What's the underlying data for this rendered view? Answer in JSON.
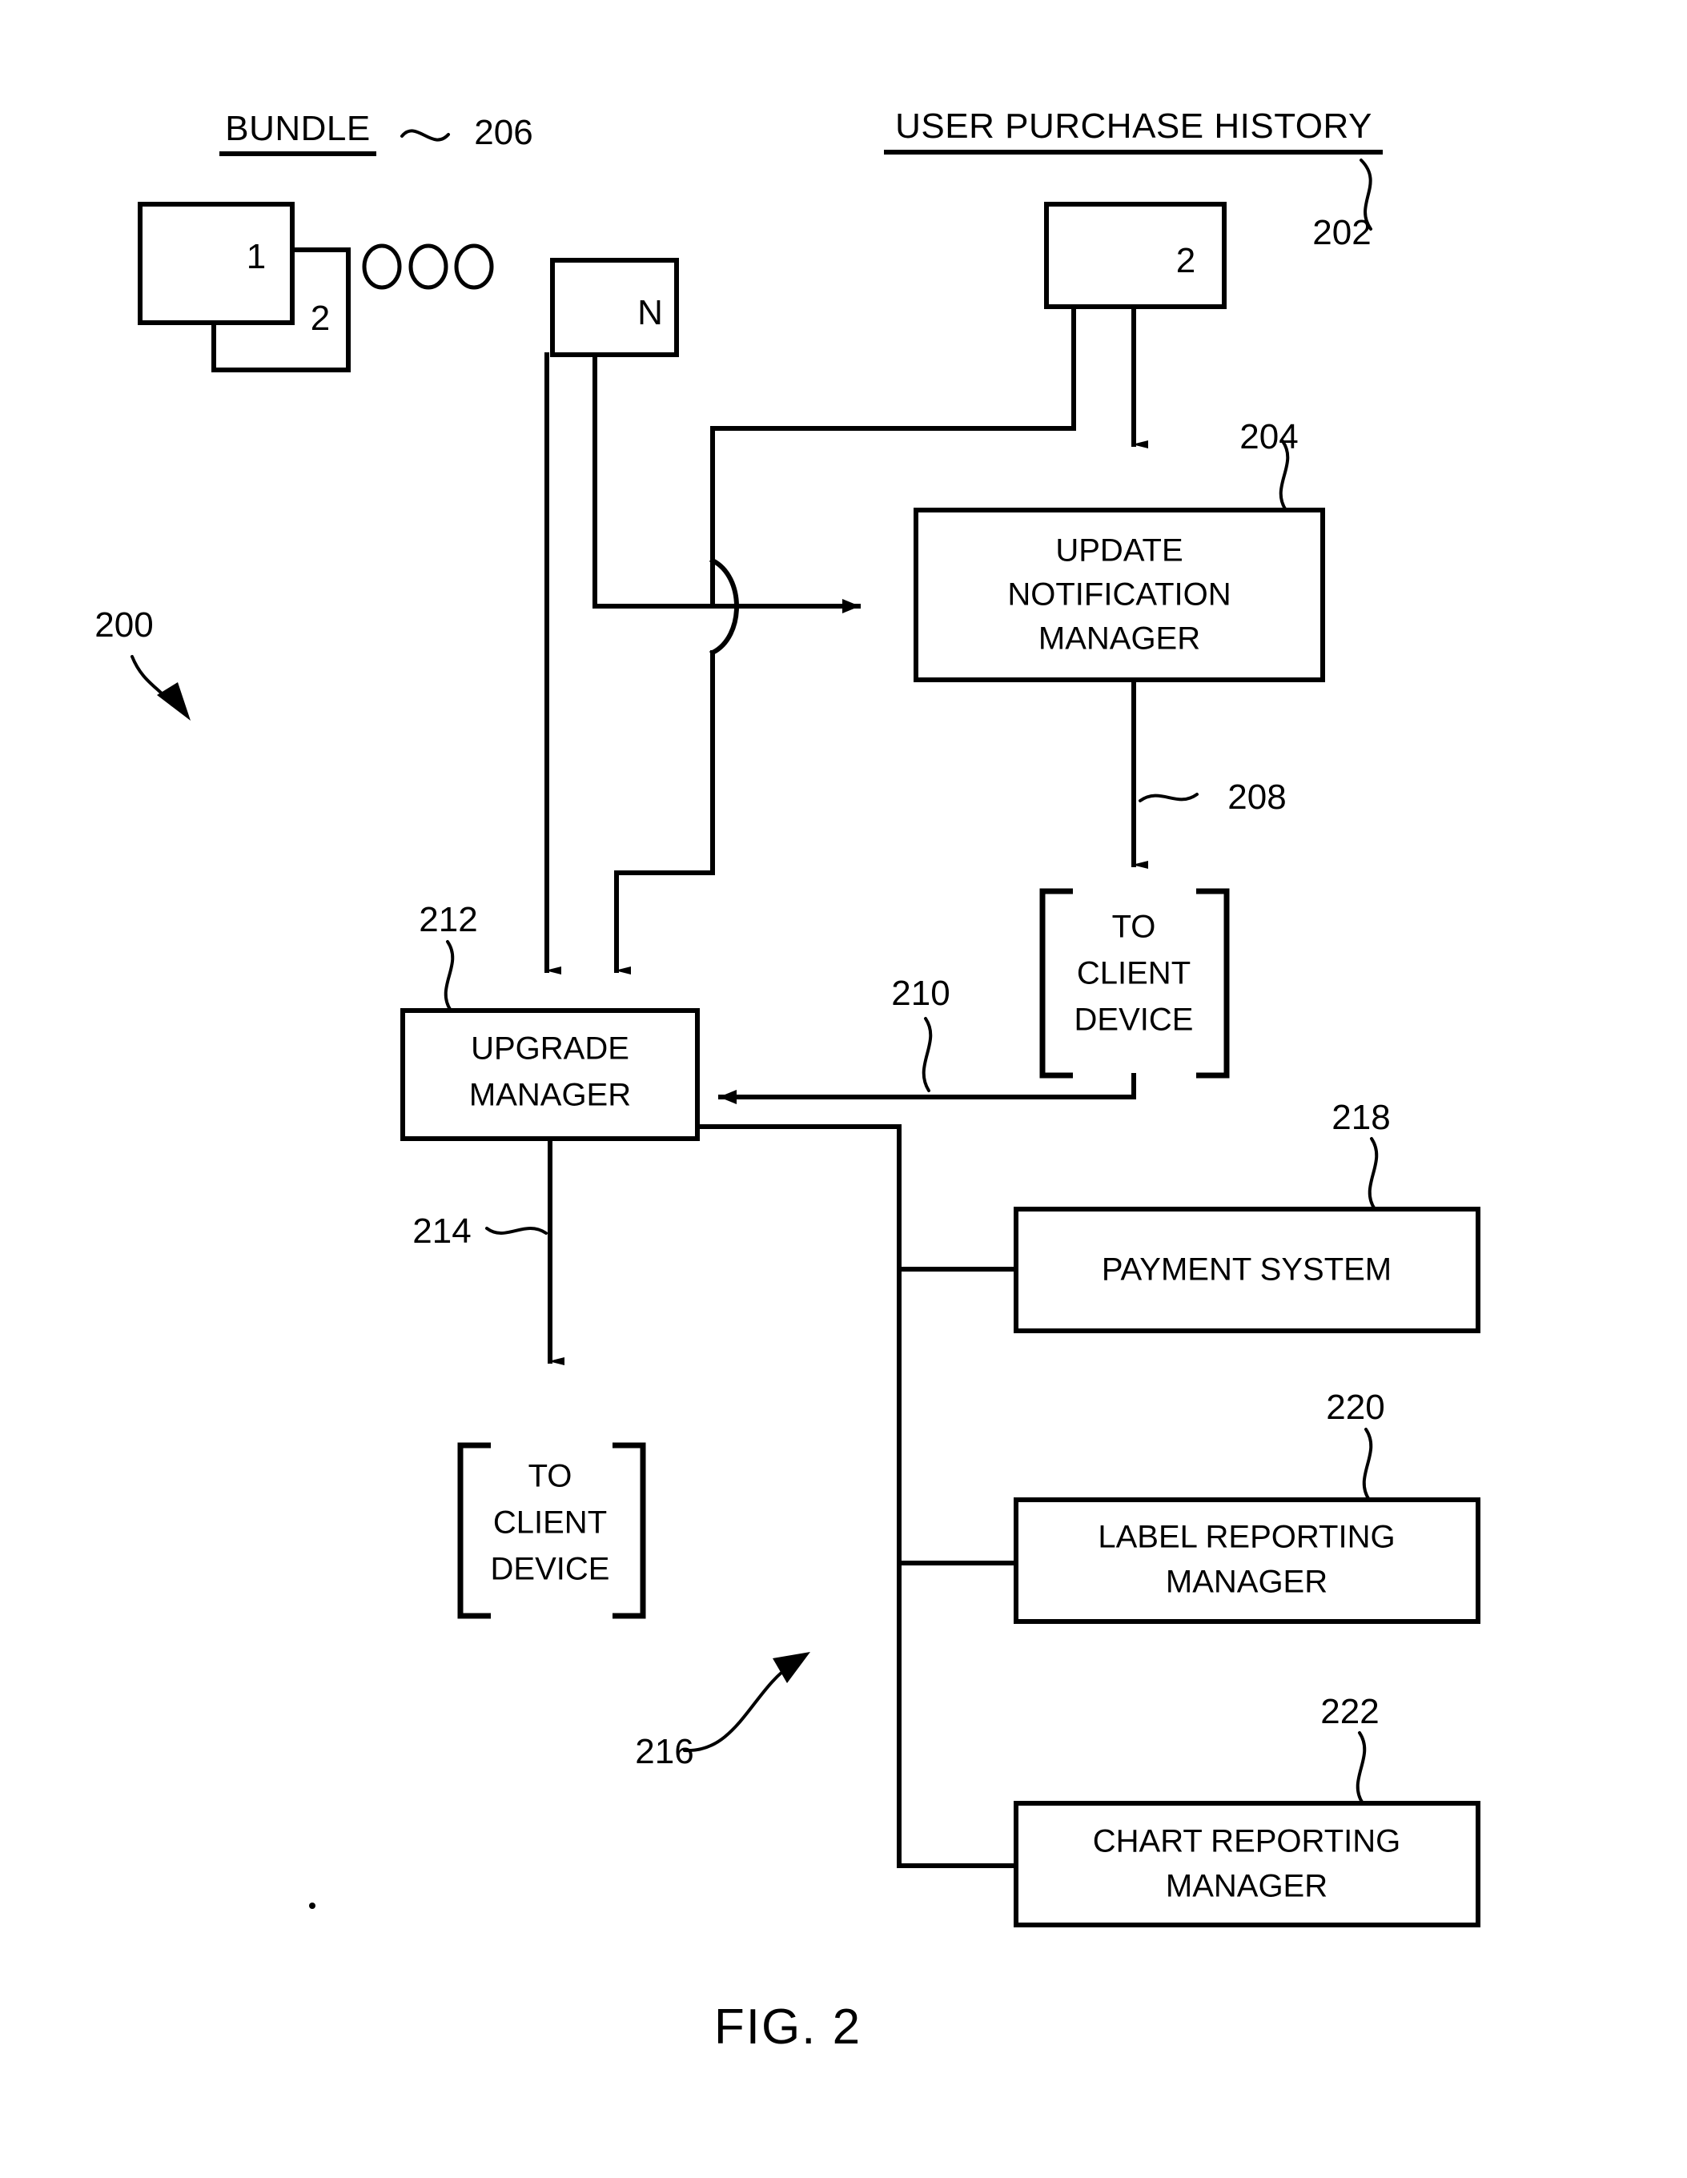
{
  "figure": {
    "caption": "FIG. 2",
    "system_ref": "200"
  },
  "headings": [
    {
      "id": "bundle",
      "text": "BUNDLE",
      "ref": "206"
    },
    {
      "id": "user_purchase_history",
      "text": "USER PURCHASE HISTORY",
      "ref": "202"
    }
  ],
  "bundle": {
    "title": "BUNDLE",
    "ref": "206",
    "items": [
      {
        "label": "1"
      },
      {
        "label": "2"
      },
      {
        "label": "N"
      }
    ],
    "ellipsis": "○ ○ ○"
  },
  "purchase_history": {
    "title": "USER PURCHASE HISTORY",
    "ref": "202",
    "item_label": "2"
  },
  "blocks": [
    {
      "id": "update-notification-manager",
      "lines": [
        "UPDATE",
        "NOTIFICATION",
        "MANAGER"
      ],
      "ref": "204"
    },
    {
      "id": "upgrade-manager",
      "lines": [
        "UPGRADE",
        "MANAGER"
      ],
      "ref": "212"
    },
    {
      "id": "payment-system",
      "lines": [
        "PAYMENT SYSTEM"
      ],
      "ref": "218"
    },
    {
      "id": "label-reporting-manager",
      "lines": [
        "LABEL REPORTING",
        "MANAGER"
      ],
      "ref": "220"
    },
    {
      "id": "chart-reporting-manager",
      "lines": [
        "CHART REPORTING",
        "MANAGER"
      ],
      "ref": "222"
    }
  ],
  "terminals": [
    {
      "id": "to-client-device-top",
      "lines": [
        "TO",
        "CLIENT",
        "DEVICE"
      ],
      "ref": "208"
    },
    {
      "id": "to-client-device-bottom",
      "lines": [
        "TO",
        "CLIENT",
        "DEVICE"
      ],
      "ref": "214"
    }
  ],
  "connector_refs": [
    {
      "id": "ref-200",
      "value": "200"
    },
    {
      "id": "ref-202",
      "value": "202"
    },
    {
      "id": "ref-204",
      "value": "204"
    },
    {
      "id": "ref-206",
      "value": "206"
    },
    {
      "id": "ref-208",
      "value": "208"
    },
    {
      "id": "ref-210",
      "value": "210"
    },
    {
      "id": "ref-212",
      "value": "212"
    },
    {
      "id": "ref-214",
      "value": "214"
    },
    {
      "id": "ref-216",
      "value": "216"
    },
    {
      "id": "ref-218",
      "value": "218"
    },
    {
      "id": "ref-220",
      "value": "220"
    },
    {
      "id": "ref-222",
      "value": "222"
    }
  ],
  "colors": {
    "ink": "#000000",
    "paper": "#ffffff"
  }
}
